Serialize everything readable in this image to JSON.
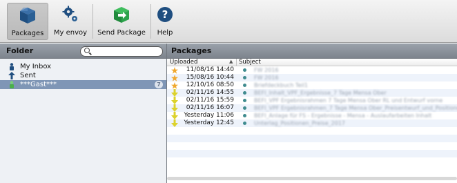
{
  "toolbar": {
    "buttons": [
      {
        "label": "Packages",
        "icon": "package-box-icon",
        "active": true
      },
      {
        "label": "My envoy",
        "icon": "gears-icon",
        "active": false
      },
      {
        "label": "Send Package",
        "icon": "send-package-icon",
        "active": false
      },
      {
        "label": "Help",
        "icon": "help-question-icon",
        "active": false
      }
    ]
  },
  "left": {
    "title": "Folder",
    "search_placeholder": "",
    "folders": [
      {
        "label": "My Inbox",
        "icon": "inbox-person-icon"
      },
      {
        "label": "Sent",
        "icon": "sent-arrow-icon"
      },
      {
        "label": "***Gast***",
        "icon": "guest-person-icon",
        "badge": "7",
        "selected": true
      }
    ]
  },
  "right": {
    "title": "Packages",
    "col_uploaded": "Uploaded",
    "col_sort": "▲",
    "col_subject": "Subject",
    "rows": [
      {
        "icon": "star-icon",
        "date": "11/08/16 14:40",
        "subject": "FW 2016"
      },
      {
        "icon": "star-icon",
        "date": "15/08/16 10:44",
        "subject": "FW 2016"
      },
      {
        "icon": "star-icon",
        "date": "12/10/16 08:50",
        "subject": "Briefdeckbuch Teil1"
      },
      {
        "icon": "download-arrow-icon",
        "date": "02/11/16 14:55",
        "subject": "BEFI_Inhalt_VPF_Ergebnisse_7 Tage Mensa Ober"
      },
      {
        "icon": "download-arrow-icon",
        "date": "02/11/16 15:59",
        "subject": "BEFI_VPF Ergebnisrahmen 7 Tage Mensa Ober RL und Entwurf vorne"
      },
      {
        "icon": "download-arrow-icon",
        "date": "02/11/16 16:07",
        "subject": "BEFI_VPF Ergebnisrahmen_7 Tage Mensa Ober_Preisentwurf_und_Positionen"
      },
      {
        "icon": "download-arrow-icon",
        "date": "Yesterday 11:06",
        "subject": "BEFI_Anlage für FS - Ergebnisse - Mensa - Auslaufarbeiten Inhalt"
      },
      {
        "icon": "download-arrow-icon",
        "date": "Yesterday 12:45",
        "subject": "Unterlag_Positionen_Preise_2017"
      }
    ]
  },
  "colors": {
    "selection": "#7f96b6",
    "header": "#8b929b",
    "star": "#f0a82e",
    "arrow": "#d9cf2b",
    "dot": "#3f8b8f"
  }
}
